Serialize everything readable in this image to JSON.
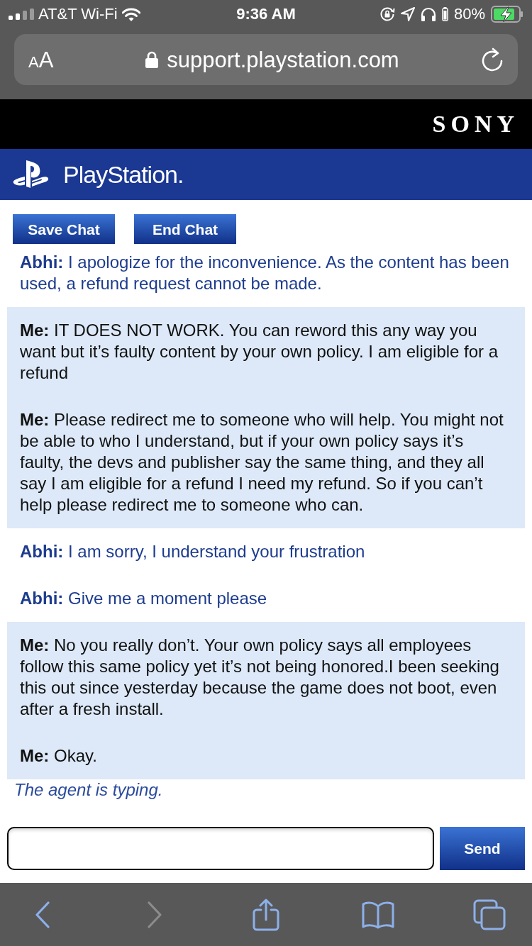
{
  "status_bar": {
    "carrier": "AT&T Wi-Fi",
    "time": "9:36 AM",
    "battery": "80%"
  },
  "address_bar": {
    "text_size_button": {
      "small": "A",
      "large": "A"
    },
    "url": "support.playstation.com"
  },
  "brand_bar": {
    "logo": "SONY"
  },
  "site_header": {
    "logo": "PlayStation."
  },
  "chat_buttons": [
    "Save Chat",
    "End Chat"
  ],
  "messages": [
    {
      "kind": "agent",
      "text": "**Abhi:** I apologize for the inconvenience. As the content has been used, a refund request cannot be made."
    },
    {
      "kind": "user",
      "text": "**Me:** IT DOES NOT WORK. You can reword this any way you want but it’s faulty content by your own policy. I am eligible for a refund"
    },
    {
      "kind": "user",
      "text": "**Me:** Please redirect me to someone who will help. You might not be able to who I understand, but if your own policy says it’s faulty, the devs and publisher say the same thing, and they all say I am eligible for a refund I need my refund. So if you can’t help please redirect me to someone who can."
    },
    {
      "kind": "agent",
      "text": "**Abhi:** I am sorry, I understand your frustration"
    },
    {
      "kind": "agent",
      "text": "**Abhi:** Give me a moment please"
    },
    {
      "kind": "user",
      "text": "**Me:** No you really don’t. Your own policy says all employees follow this same policy yet it’s not being honored.I been seeking this out since yesterday because the game does not boot, even after a fresh install."
    },
    {
      "kind": "user",
      "text": "**Me:** Okay."
    }
  ],
  "typing_status": "The agent is typing.",
  "composer": {
    "button": "Send"
  },
  "toolbar": [
    {
      "kind": "back",
      "disabled": false
    },
    {
      "kind": "forward",
      "disabled": true
    },
    {
      "kind": "share",
      "disabled": false
    },
    {
      "kind": "bookmarks",
      "disabled": false
    },
    {
      "kind": "tabs",
      "disabled": false
    }
  ]
}
